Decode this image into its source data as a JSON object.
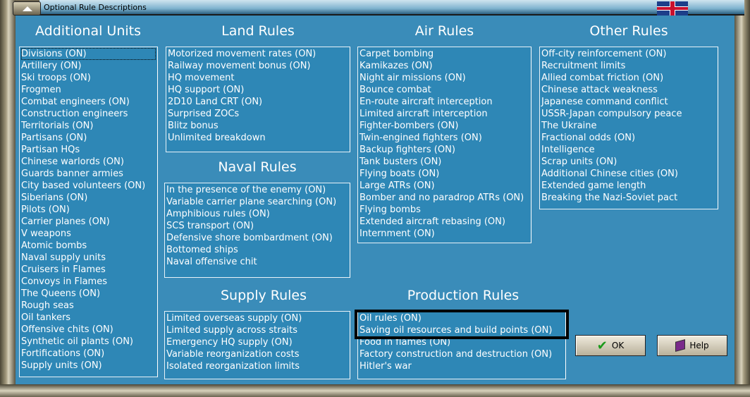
{
  "window": {
    "title": "Optional Rule Descriptions"
  },
  "sections": {
    "additional_units": {
      "title": "Additional Units",
      "items": [
        "Divisions (ON)",
        "Artillery (ON)",
        "Ski troops (ON)",
        "Frogmen",
        "Combat engineers (ON)",
        "Construction engineers",
        "Territorials (ON)",
        "Partisans (ON)",
        "Partisan HQs",
        "Chinese warlords (ON)",
        "Guards banner armies",
        "City based volunteers (ON)",
        "Siberians (ON)",
        "Pilots (ON)",
        "Carrier planes (ON)",
        "V weapons",
        "Atomic bombs",
        "Naval supply units",
        "Cruisers in Flames",
        "Convoys in Flames",
        "The Queens (ON)",
        "Rough seas",
        "Oil tankers",
        "Offensive chits (ON)",
        "Synthetic oil plants (ON)",
        "Fortifications (ON)",
        "Supply units (ON)"
      ]
    },
    "land": {
      "title": "Land Rules",
      "items": [
        "Motorized movement rates (ON)",
        "Railway movement bonus (ON)",
        "HQ movement",
        "HQ support (ON)",
        "2D10 Land CRT (ON)",
        "Surprised ZOCs",
        "Blitz bonus",
        "Unlimited breakdown"
      ]
    },
    "naval": {
      "title": "Naval Rules",
      "items": [
        "In the presence of the enemy (ON)",
        "Variable carrier plane searching (ON)",
        "Amphibious rules (ON)",
        "SCS transport (ON)",
        "Defensive shore bombardment (ON)",
        "Bottomed ships",
        "Naval offensive chit"
      ]
    },
    "supply": {
      "title": "Supply Rules",
      "items": [
        "Limited overseas supply (ON)",
        "Limited supply across straits",
        "Emergency HQ supply (ON)",
        "Variable reorganization costs",
        "Isolated reorganization limits"
      ]
    },
    "air": {
      "title": "Air Rules",
      "items": [
        "Carpet bombing",
        "Kamikazes (ON)",
        "Night air missions (ON)",
        "Bounce combat",
        "En-route aircraft interception",
        "Limited aircraft interception",
        "Fighter-bombers (ON)",
        "Twin-engined fighters (ON)",
        "Backup fighters (ON)",
        "Tank busters (ON)",
        "Flying boats (ON)",
        "Large ATRs (ON)",
        "Bomber and no paradrop ATRs (ON)",
        "Flying bombs",
        "Extended aircraft rebasing (ON)",
        "Internment (ON)"
      ]
    },
    "production": {
      "title": "Production Rules",
      "items": [
        "Oil rules (ON)",
        "Saving oil resources and build points (ON)",
        "Food in flames (ON)",
        "Factory construction and destruction (ON)",
        "Hitler's war"
      ]
    },
    "other": {
      "title": "Other Rules",
      "items": [
        "Off-city reinforcement (ON)",
        "Recruitment limits",
        "Allied combat friction (ON)",
        "Chinese attack weakness",
        "Japanese command conflict",
        "USSR-Japan compulsory peace",
        "The Ukraine",
        "Fractional odds (ON)",
        "Intelligence",
        "Scrap units (ON)",
        "Additional Chinese cities (ON)",
        "Extended game length",
        "Breaking the Nazi-Soviet pact"
      ]
    }
  },
  "buttons": {
    "ok": "OK",
    "help": "Help"
  }
}
